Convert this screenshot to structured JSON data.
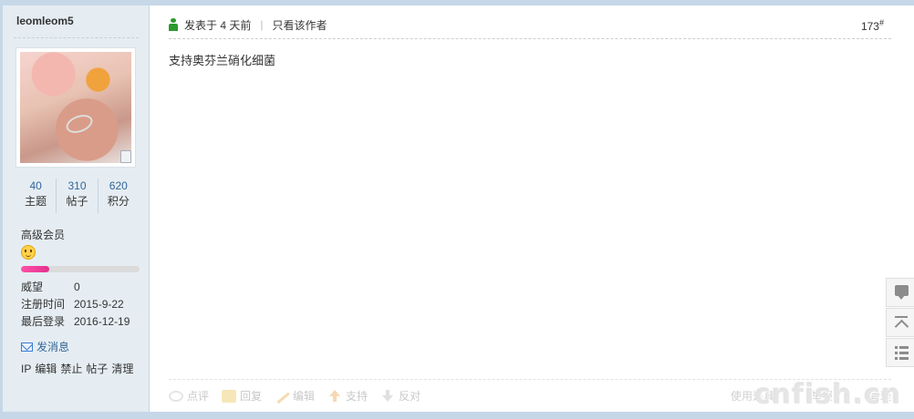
{
  "user": {
    "name": "leomleom5",
    "stats": [
      {
        "value": "40",
        "label": "主题"
      },
      {
        "value": "310",
        "label": "帖子"
      },
      {
        "value": "620",
        "label": "积分"
      }
    ],
    "group": "高级会员",
    "level_progress": 0.24,
    "info": [
      {
        "label": "威望",
        "value": "0"
      },
      {
        "label": "注册时间",
        "value": "2015-9-22"
      },
      {
        "label": "最后登录",
        "value": "2016-12-19"
      }
    ],
    "send_message": "发消息",
    "admin_links": [
      "IP",
      "编辑",
      "禁止",
      "帖子",
      "清理"
    ]
  },
  "post": {
    "time": "发表于 4 天前",
    "separator": "|",
    "author_only": "只看该作者",
    "floor": "173",
    "floor_mark": "#",
    "content": "支持奥芬兰硝化细菌",
    "actions": [
      "点评",
      "回复",
      "编辑",
      "支持",
      "反对"
    ],
    "right_actions": [
      "使用道具",
      "举报",
      "管理"
    ]
  },
  "watermark": "cnfish.cn",
  "colors": {
    "sidebar_bg": "#e5edf2",
    "link": "#336699",
    "progress": "#e2338f"
  }
}
